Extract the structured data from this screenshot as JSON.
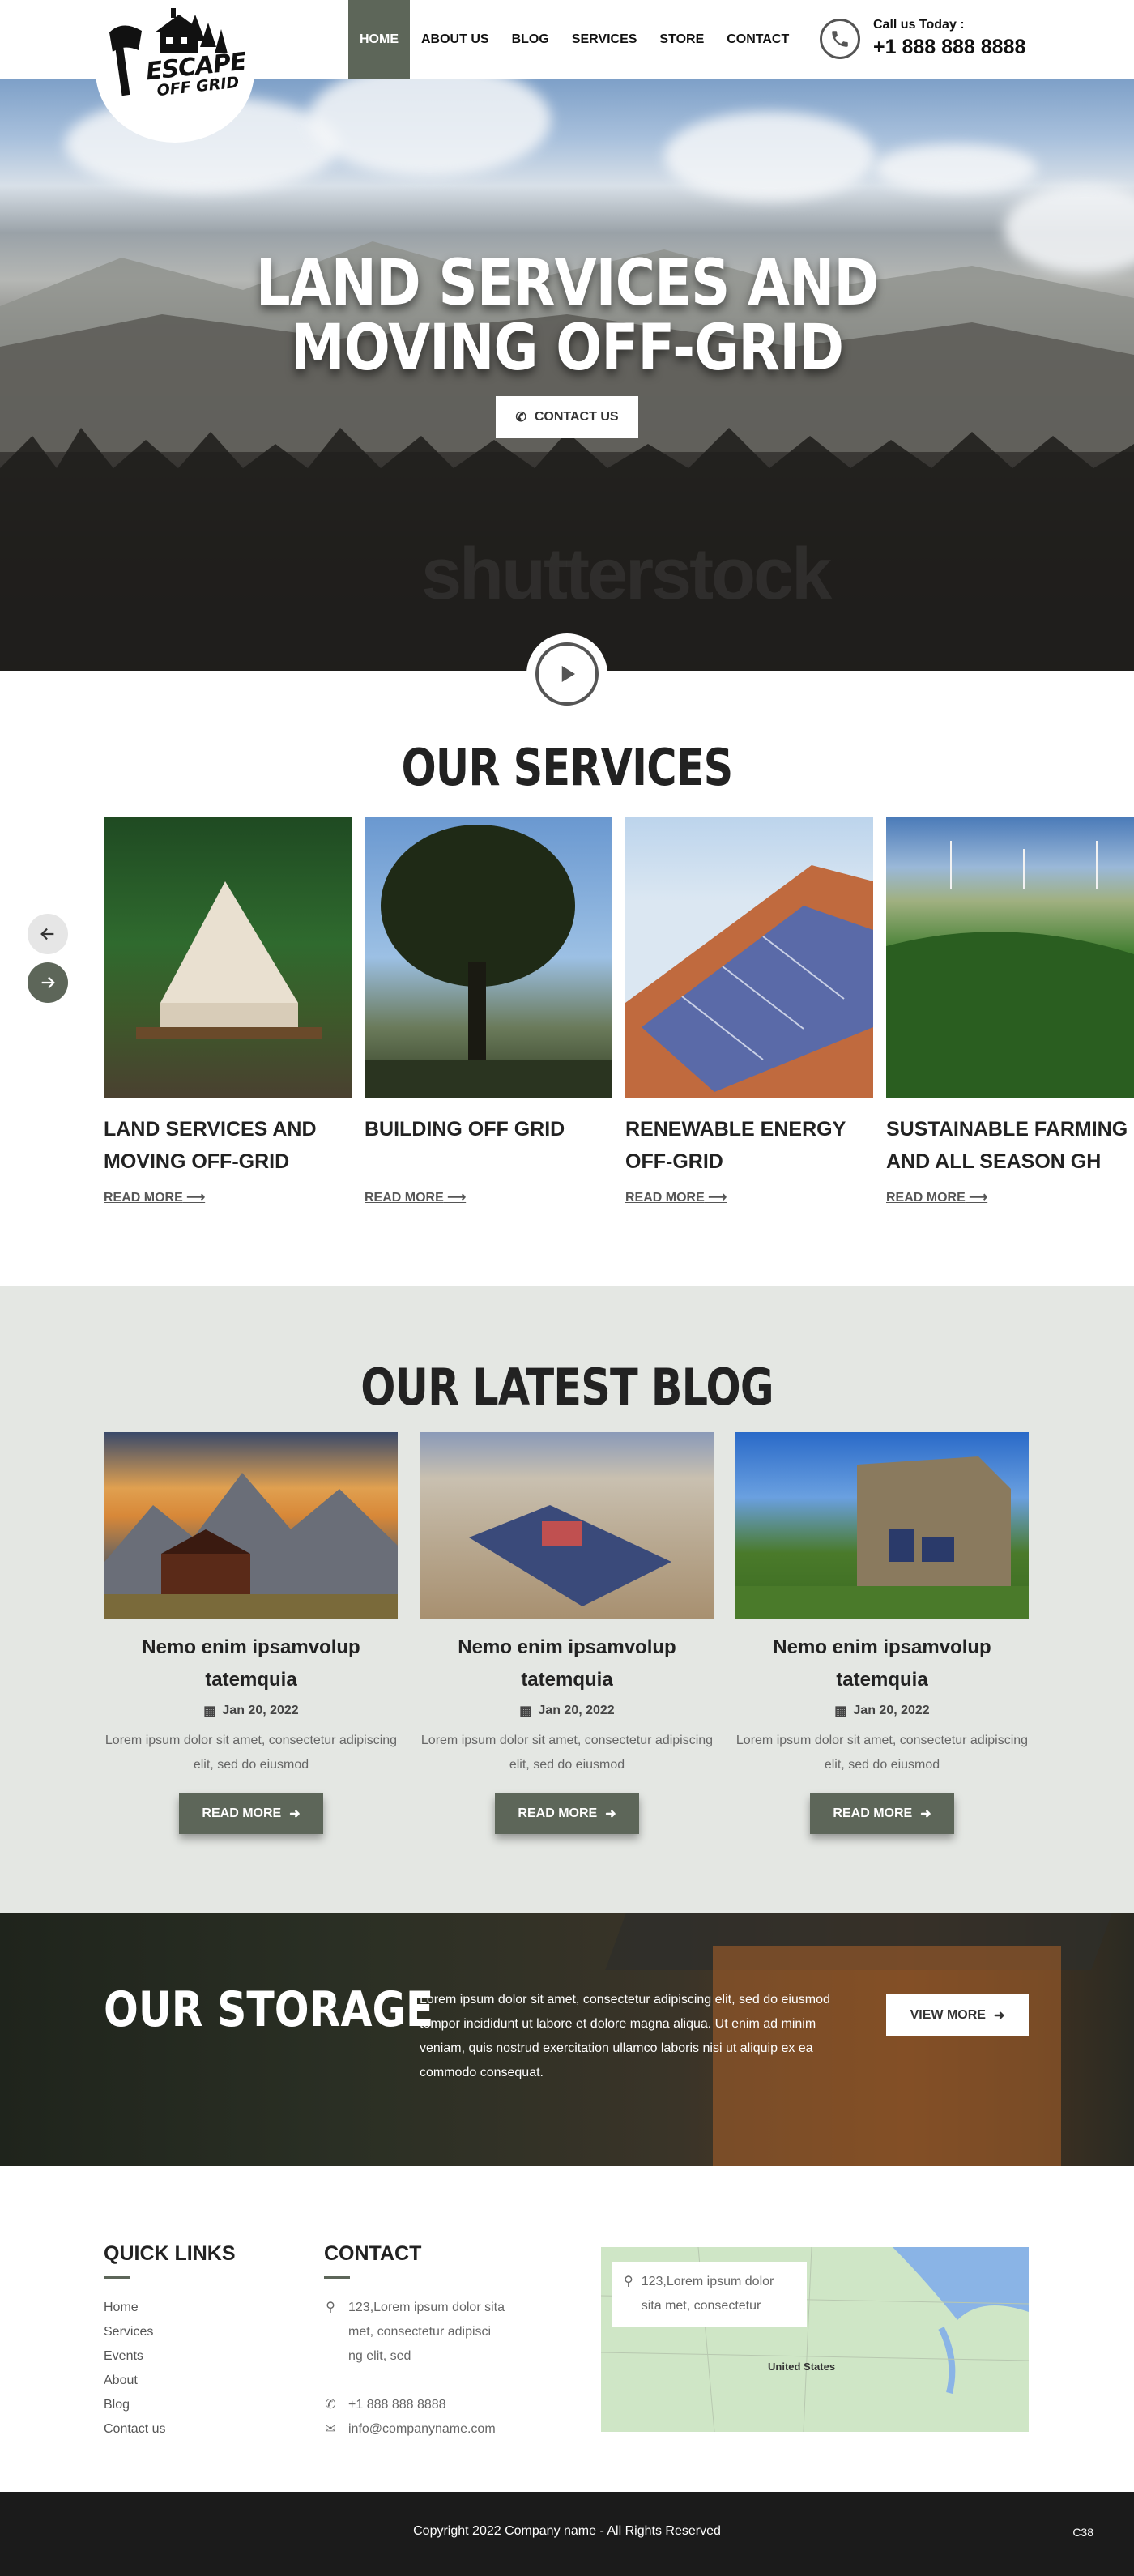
{
  "header": {
    "logo_top": "ESCAPE",
    "logo_bottom": "OFF GRID",
    "nav": [
      {
        "label": "HOME",
        "active": true
      },
      {
        "label": "ABOUT US",
        "active": false
      },
      {
        "label": "BLOG",
        "active": false
      },
      {
        "label": "SERVICES",
        "active": false
      },
      {
        "label": "STORE",
        "active": false
      },
      {
        "label": "CONTACT",
        "active": false
      }
    ],
    "call_label": "Call us Today :",
    "call_number": "+1 888 888 8888"
  },
  "hero": {
    "title_line1": "LAND SERVICES AND",
    "title_line2": "MOVING OFF-GRID",
    "button_label": "CONTACT US",
    "watermark": "shutterstock"
  },
  "services": {
    "title": "OUR SERVICES",
    "cards": [
      {
        "title": "LAND SERVICES AND MOVING OFF-GRID",
        "more": "READ MORE"
      },
      {
        "title": "BUILDING OFF GRID",
        "more": "READ MORE"
      },
      {
        "title": "RENEWABLE ENERGY OFF-GRID",
        "more": "READ MORE"
      },
      {
        "title": "SUSTAINABLE FARMING AND ALL SEASON GH",
        "more": "READ MORE"
      }
    ]
  },
  "blog": {
    "title": "OUR LATEST BLOG",
    "posts": [
      {
        "title": "Nemo enim ipsamvolup tatemquia",
        "date": "Jan 20, 2022",
        "desc": "Lorem ipsum dolor sit amet, consectetur adipiscing elit, sed do eiusmod",
        "button": "READ MORE"
      },
      {
        "title": "Nemo enim ipsamvolup tatemquia",
        "date": "Jan 20, 2022",
        "desc": "Lorem ipsum dolor sit amet, consectetur adipiscing elit, sed do eiusmod",
        "button": "READ MORE"
      },
      {
        "title": "Nemo enim ipsamvolup tatemquia",
        "date": "Jan 20, 2022",
        "desc": "Lorem ipsum dolor sit amet, consectetur adipiscing elit, sed do eiusmod",
        "button": "READ MORE"
      }
    ]
  },
  "storage": {
    "title": "OUR STORAGE",
    "text": "Lorem ipsum dolor sit amet, consectetur adipiscing elit, sed do eiusmod tempor incididunt ut labore et dolore magna aliqua. Ut enim ad minim veniam, quis nostrud exercitation ullamco laboris nisi ut aliquip ex ea commodo consequat.",
    "button_label": "VIEW MORE"
  },
  "footer": {
    "quick_links_title": "QUICK LINKS",
    "quick_links": [
      "Home",
      "Services",
      "Events",
      "About",
      "Blog",
      "Contact us"
    ],
    "contact_title": "CONTACT",
    "address_lines": [
      "123,Lorem ipsum dolor sita",
      "met, consectetur adipisci",
      "ng elit, sed"
    ],
    "phone": "+1 888 888 8888",
    "email": "info@companyname.com",
    "map_address_lines": [
      "123,Lorem ipsum dolor",
      "sita met, consectetur"
    ],
    "map_label": "United States",
    "copyright": "Copyright 2022 Company name - All Rights Reserved",
    "code": "C38"
  },
  "colors": {
    "accent": "#5d6659",
    "footer_bg": "#1b1b1b",
    "blog_bg": "#e4e7e3"
  }
}
